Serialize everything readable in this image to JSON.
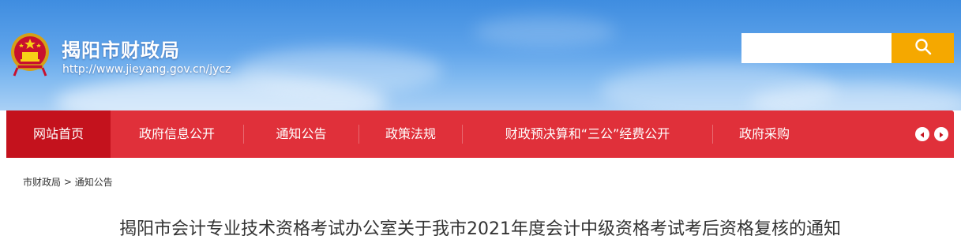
{
  "header": {
    "site_title": "揭阳市财政局",
    "site_url": "http://www.jieyang.gov.cn/jycz",
    "emblem_icon": "national-emblem-icon"
  },
  "search": {
    "placeholder": "",
    "value": "",
    "button_icon": "search-icon",
    "button_color": "#f5a800"
  },
  "nav": {
    "items": [
      {
        "label": "网站首页",
        "active": true
      },
      {
        "label": "政府信息公开",
        "active": false
      },
      {
        "label": "通知公告",
        "active": false
      },
      {
        "label": "政策法规",
        "active": false
      },
      {
        "label": "财政预决算和“三公”经费公开",
        "active": false
      },
      {
        "label": "政府采购",
        "active": false
      }
    ],
    "prev_icon": "chevron-left-icon",
    "next_icon": "chevron-right-icon",
    "bar_color": "#e0303a",
    "active_color": "#c4121d"
  },
  "breadcrumb": {
    "items": [
      "市财政局",
      "通知公告"
    ],
    "separator": ">"
  },
  "article": {
    "title": "揭阳市会计专业技术资格考试办公室关于我市2021年度会计中级资格考试考后资格复核的通知"
  }
}
